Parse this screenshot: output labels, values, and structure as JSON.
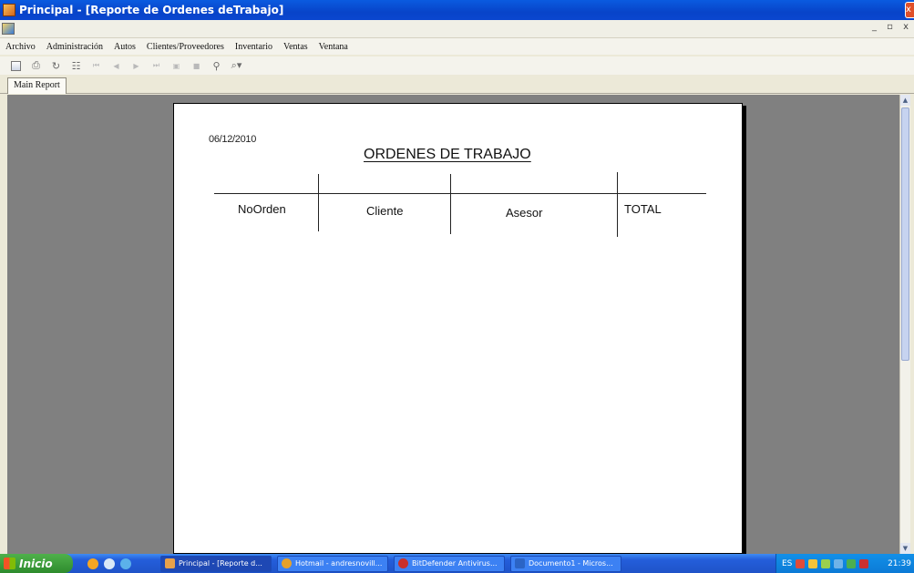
{
  "window": {
    "title": "Principal - [Reporte de Ordenes deTrabajo]",
    "close_glyph": "x"
  },
  "mdi": {
    "controls": "_ ▫ x"
  },
  "menu": [
    "Archivo",
    "Administración",
    "Autos",
    "Clientes/Proveedores",
    "Inventario",
    "Ventas",
    "Ventana"
  ],
  "toolbar": {
    "icons": [
      "export-icon",
      "print-icon",
      "refresh-icon",
      "group-tree-icon",
      "first-page-icon",
      "previous-page-icon",
      "next-page-icon",
      "last-page-icon",
      "goto-page-icon",
      "stop-icon",
      "search-icon",
      "zoom-icon"
    ]
  },
  "report_tab": {
    "label": "Main Report"
  },
  "report": {
    "date": "06/12/2010",
    "title": "ORDENES DE TRABAJO",
    "columns": [
      "NoOrden",
      "Cliente",
      "Asesor",
      "TOTAL"
    ]
  },
  "taskbar": {
    "start_label": "Inicio",
    "tasks": [
      {
        "label": "Principal - [Reporte d...",
        "color": "#e8a14a",
        "active": true
      },
      {
        "label": "Hotmail - andresnovill...",
        "color": "#e6a12a",
        "active": false
      },
      {
        "label": "BitDefender Antivirus...",
        "color": "#c9302c",
        "active": false
      },
      {
        "label": "Documento1 - Micros...",
        "color": "#2b64c5",
        "active": false
      }
    ],
    "tray": {
      "lang": "ES",
      "time": "21:39"
    }
  },
  "colors": {
    "titlebar": "#0a5be0",
    "viewer_bg": "#808080",
    "taskbar": "#245edb",
    "start": "#2e8b2d"
  }
}
